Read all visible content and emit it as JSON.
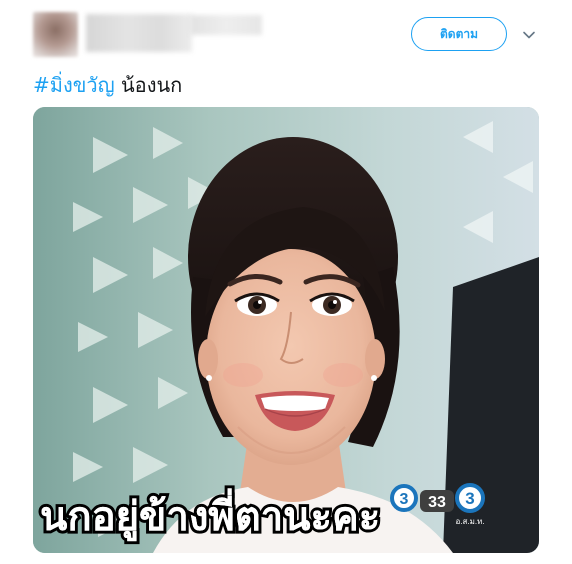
{
  "tweet": {
    "follow_label": "ติดตาม",
    "hashtag": "#มิ่งขวัญ",
    "text": " น้องนก"
  },
  "media": {
    "subtitle": "นกอยู่ข้างพี่ตานะคะ",
    "logo_numbers": "33",
    "logo_caption": "อ.ส.ม.ท."
  },
  "icons": {
    "caret": "chevron-down-icon",
    "logo": "channel-3-logo"
  },
  "colors": {
    "accent": "#1da1f2",
    "text": "#14171a"
  }
}
